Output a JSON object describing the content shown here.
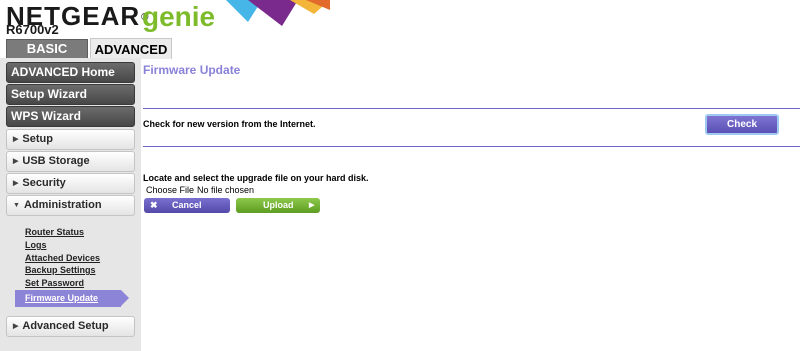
{
  "header": {
    "brand": "NETGEAR",
    "registered": "®",
    "genie": "genie",
    "model": "R6700v2"
  },
  "tabs": [
    {
      "label": "BASIC"
    },
    {
      "label": "ADVANCED"
    }
  ],
  "sidebar": {
    "dark_items": [
      "ADVANCED Home",
      "Setup Wizard",
      "WPS Wizard"
    ],
    "sections": [
      "Setup",
      "USB Storage",
      "Security",
      "Administration",
      "Advanced Setup"
    ],
    "admin_links": [
      "Router Status",
      "Logs",
      "Attached Devices",
      "Backup Settings",
      "Set Password",
      "Firmware Update"
    ],
    "arrow_collapsed": "▶",
    "arrow_expanded": "▼"
  },
  "main": {
    "title": "Firmware Update",
    "check_text": "Check for new version from the Internet.",
    "check_button": "Check",
    "locate_text": "Locate and select the upgrade file on your hard disk.",
    "choose_file": "Choose File",
    "file_status": "No file chosen",
    "cancel_button": "Cancel",
    "cancel_icon": "✖",
    "upload_button": "Upload",
    "upload_icon": "▶"
  },
  "colors": {
    "accent_purple": "#8a82d9",
    "button_purple": "#5a51b3",
    "button_green": "#6aa82a",
    "sidebar_bg": "#e6e6e6"
  }
}
